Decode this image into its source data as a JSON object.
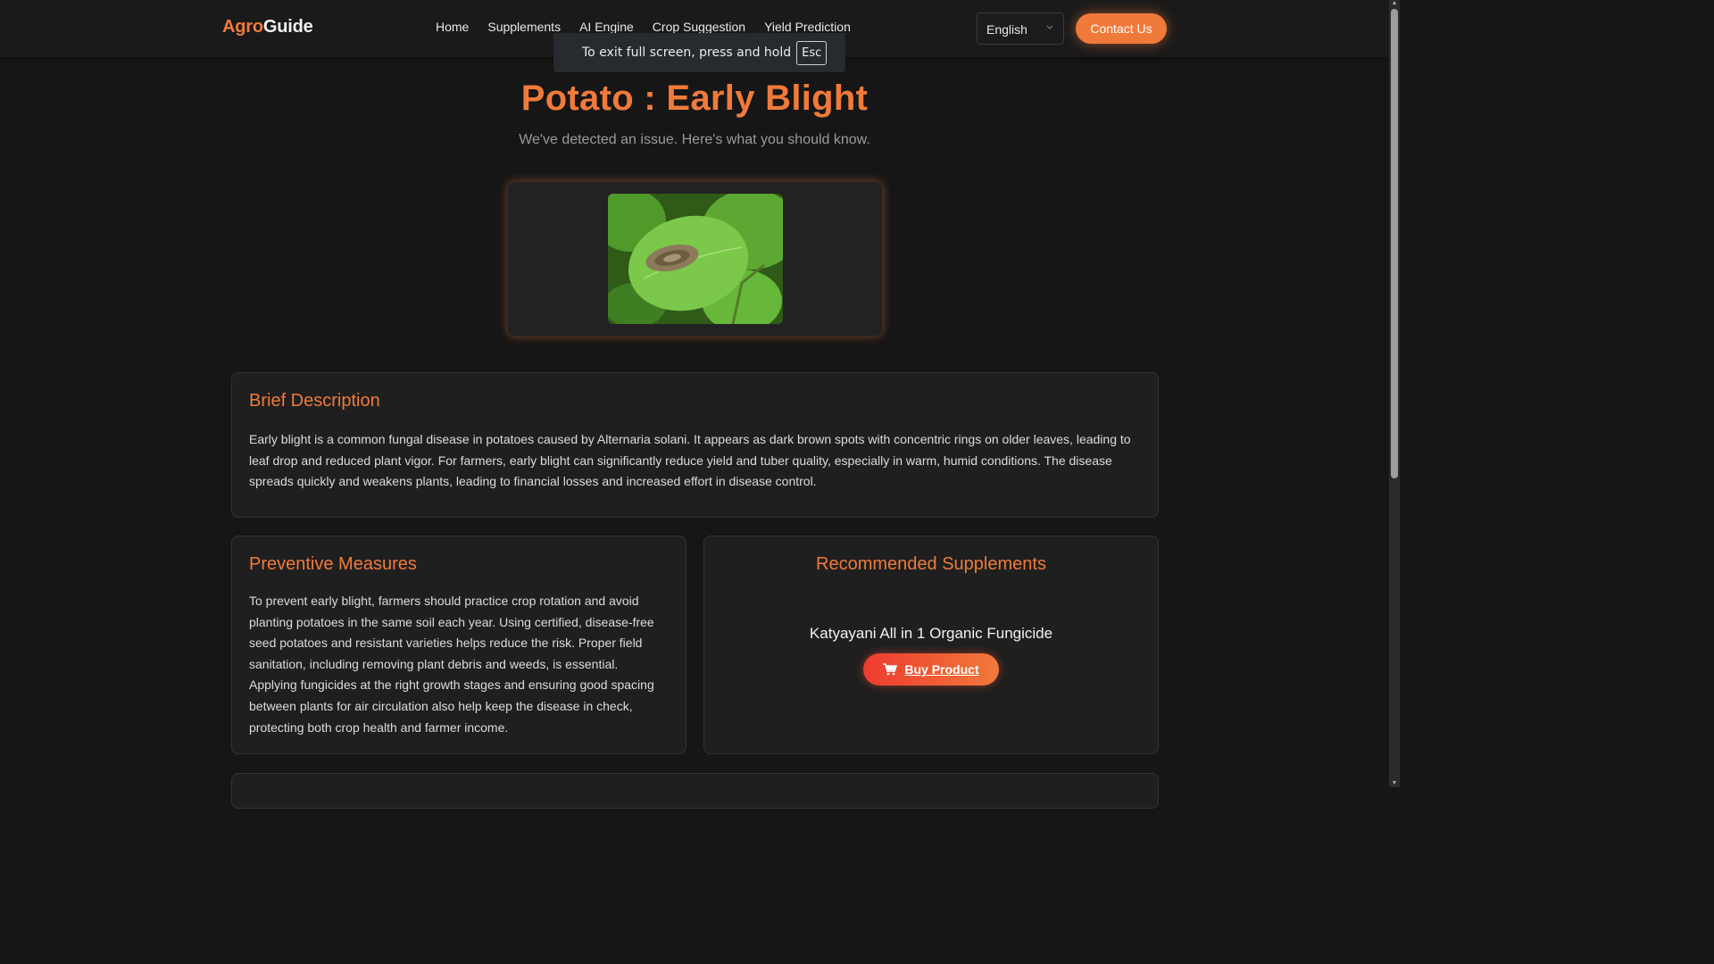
{
  "brand": {
    "part1": "Agro",
    "part2": "Guide"
  },
  "nav": [
    "Home",
    "Supplements",
    "AI Engine",
    "Crop Suggestion",
    "Yield Prediction"
  ],
  "language": {
    "selected": "English"
  },
  "contact_label": "Contact Us",
  "fullscreen_notice": {
    "text": "To exit full screen, press and hold",
    "key": "Esc"
  },
  "hero": {
    "title": "Potato : Early Blight",
    "subtitle": "We've detected an issue. Here's what you should know."
  },
  "brief": {
    "heading": "Brief Description",
    "text": "Early blight is a common fungal disease in potatoes caused by Alternaria solani. It appears as dark brown spots with concentric rings on older leaves, leading to leaf drop and reduced plant vigor. For farmers, early blight can significantly reduce yield and tuber quality, especially in warm, humid conditions. The disease spreads quickly and weakens plants, leading to financial losses and increased effort in disease control."
  },
  "preventive": {
    "heading": "Preventive Measures",
    "text": "To prevent early blight, farmers should practice crop rotation and avoid planting potatoes in the same soil each year. Using certified, disease-free seed potatoes and resistant varieties helps reduce the risk. Proper field sanitation, including removing plant debris and weeds, is essential. Applying fungicides at the right growth stages and ensuring good spacing between plants for air circulation also help keep the disease in check, protecting both crop health and farmer income."
  },
  "supplements": {
    "heading": "Recommended Supplements",
    "product_name": "Katyayani All in 1 Organic Fungicide",
    "buy_label": "Buy Product"
  },
  "colors": {
    "accent": "#f07a3a",
    "background": "#161616",
    "card": "#1f1f1f"
  }
}
